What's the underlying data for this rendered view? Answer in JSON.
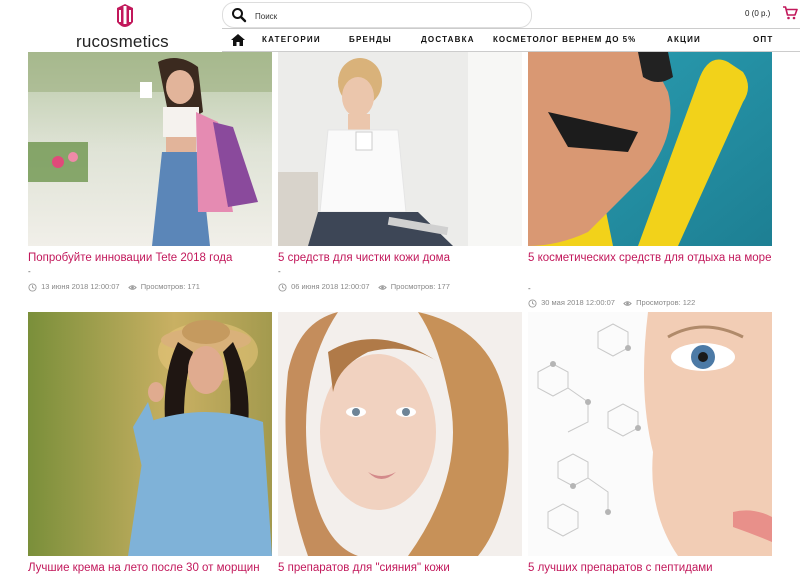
{
  "brand": {
    "name": "rucosmetics",
    "color": "#c2185b"
  },
  "search": {
    "placeholder": "Поиск"
  },
  "cart": {
    "text": "0 (0 р.)"
  },
  "nav": {
    "items": [
      "КАТЕГОРИИ",
      "БРЕНДЫ",
      "ДОСТАВКА",
      "КОСМЕТОЛОГ ВЕРНЕМ ДО 5%",
      "АКЦИИ",
      "ОПТ"
    ]
  },
  "articles": [
    {
      "title": "Попробуйте инновации Tete 2018 года",
      "dash": "-",
      "date": "13 июня 2018 12:00:07",
      "views": "Просмотров: 171"
    },
    {
      "title": "5 средств для чистки кожи дома",
      "dash": "-",
      "date": "06 июня 2018 12:00:07",
      "views": "Просмотров: 177"
    },
    {
      "title": "5 косметических средств для отдыха на море",
      "dash": "-",
      "date": "30 мая 2018 12:00:07",
      "views": "Просмотров: 122"
    },
    {
      "title": "Лучшие крема на лето после 30 от морщин"
    },
    {
      "title": "5 препаратов для \"сияния\" кожи"
    },
    {
      "title": "5 лучших препаратов с пептидами"
    }
  ]
}
